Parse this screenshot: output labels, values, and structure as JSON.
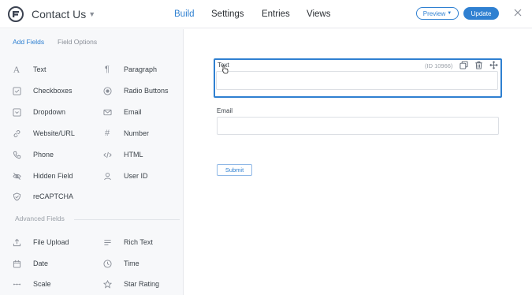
{
  "app": {
    "form_title": "Contact Us"
  },
  "nav": {
    "tabs": [
      {
        "label": "Build",
        "active": true
      },
      {
        "label": "Settings",
        "active": false
      },
      {
        "label": "Entries",
        "active": false
      },
      {
        "label": "Views",
        "active": false
      }
    ],
    "preview_label": "Preview",
    "update_label": "Update"
  },
  "sidebar": {
    "tabs": [
      {
        "label": "Add Fields",
        "active": true
      },
      {
        "label": "Field Options",
        "active": false
      }
    ],
    "fields": [
      {
        "label": "Text",
        "icon": "text-icon"
      },
      {
        "label": "Paragraph",
        "icon": "paragraph-icon"
      },
      {
        "label": "Checkboxes",
        "icon": "checkbox-icon"
      },
      {
        "label": "Radio Buttons",
        "icon": "radio-icon"
      },
      {
        "label": "Dropdown",
        "icon": "dropdown-icon"
      },
      {
        "label": "Email",
        "icon": "email-icon"
      },
      {
        "label": "Website/URL",
        "icon": "link-icon"
      },
      {
        "label": "Number",
        "icon": "hash-icon"
      },
      {
        "label": "Phone",
        "icon": "phone-icon"
      },
      {
        "label": "HTML",
        "icon": "code-icon"
      },
      {
        "label": "Hidden Field",
        "icon": "hidden-icon"
      },
      {
        "label": "User ID",
        "icon": "user-icon"
      },
      {
        "label": "reCAPTCHA",
        "icon": "shield-icon"
      }
    ],
    "advanced_label": "Advanced Fields",
    "advanced_fields": [
      {
        "label": "File Upload",
        "icon": "upload-icon"
      },
      {
        "label": "Rich Text",
        "icon": "rich-text-icon"
      },
      {
        "label": "Date",
        "icon": "calendar-icon"
      },
      {
        "label": "Time",
        "icon": "clock-icon"
      },
      {
        "label": "Scale",
        "icon": "scale-icon"
      },
      {
        "label": "Star Rating",
        "icon": "star-icon"
      }
    ]
  },
  "canvas": {
    "fields": [
      {
        "label": "Text",
        "id_text": "(ID 10966)"
      },
      {
        "label": "Email"
      }
    ],
    "submit_label": "Submit"
  },
  "colors": {
    "accent": "#2f80d1",
    "sidebar_bg": "#f7f8fa"
  }
}
